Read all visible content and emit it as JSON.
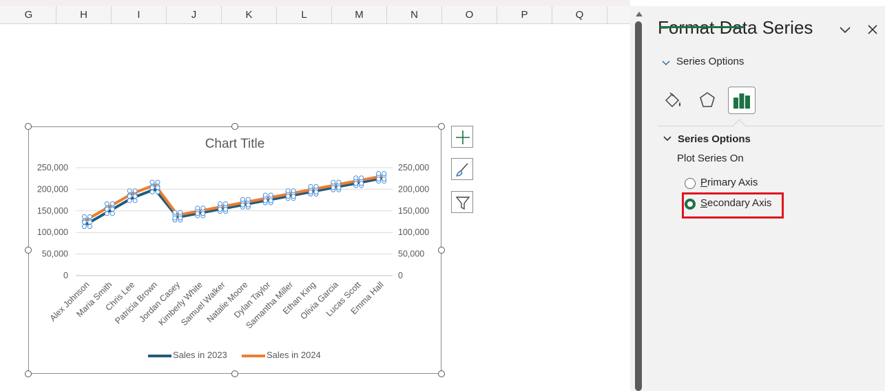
{
  "columns": [
    "G",
    "H",
    "I",
    "J",
    "K",
    "L",
    "M",
    "N",
    "O",
    "P",
    "Q"
  ],
  "chart": {
    "title": "Chart Title",
    "legend": [
      {
        "label": "Sales in 2023",
        "color": "#1f5c7a"
      },
      {
        "label": "Sales in 2024",
        "color": "#ed7d31"
      }
    ]
  },
  "chart_data": {
    "type": "line",
    "title": "Chart Title",
    "categories": [
      "Alex Johnson",
      "Maria Smith",
      "Chris Lee",
      "Patricia Brown",
      "Jordan Casey",
      "Kimberly White",
      "Samuel Walker",
      "Natalie Moore",
      "Dylan Taylor",
      "Samantha Miller",
      "Ethan King",
      "Olivia Garcia",
      "Lucas Scott",
      "Emma Hall"
    ],
    "series": [
      {
        "name": "Sales in 2023",
        "color": "#1f5c7a",
        "values": [
          120000,
          150000,
          180000,
          200000,
          135000,
          145000,
          155000,
          165000,
          175000,
          185000,
          195000,
          205000,
          215000,
          225000
        ]
      },
      {
        "name": "Sales in 2024",
        "color": "#ed7d31",
        "values": [
          130000,
          160000,
          190000,
          210000,
          140000,
          150000,
          160000,
          170000,
          180000,
          190000,
          200000,
          210000,
          220000,
          230000
        ]
      }
    ],
    "primary_y_ticks": [
      "250,000",
      "200,000",
      "150,000",
      "100,000",
      "50,000",
      "0"
    ],
    "secondary_y_ticks": [
      "250,000",
      "200,000",
      "150,000",
      "100,000",
      "50,000",
      "0"
    ],
    "ylim": [
      0,
      250000
    ],
    "grid": true,
    "legend_position": "bottom"
  },
  "chart_side_buttons": [
    {
      "name": "chart-elements-button",
      "icon": "plus-icon"
    },
    {
      "name": "chart-styles-button",
      "icon": "paintbrush-icon"
    },
    {
      "name": "chart-filters-button",
      "icon": "filter-icon"
    }
  ],
  "panel": {
    "title": "Format Data Series",
    "tab_label": "Series Options",
    "icon_tabs": [
      "fill-line-icon",
      "effects-pentagon-icon",
      "series-options-bars-icon"
    ],
    "section_title": "Series Options",
    "plot_on_label": "Plot Series On",
    "primary_axis": {
      "label_first": "P",
      "label_rest": "rimary Axis",
      "selected": false
    },
    "secondary_axis": {
      "label_first": "S",
      "label_rest": "econdary Axis",
      "selected": true
    },
    "accent_color": "#1e7145",
    "highlight_color": "#e0141e"
  }
}
